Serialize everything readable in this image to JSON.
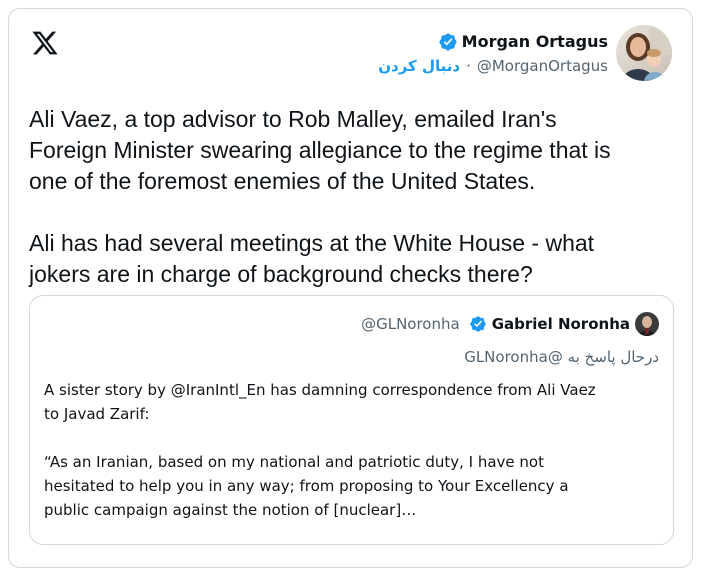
{
  "header": {
    "logo_icon": "x-logo-icon",
    "author_name": "Morgan Ortagus",
    "author_handle": "@MorganOrtagus",
    "separator": "·",
    "follow_label": "دنبال کردن",
    "verified_icon": "verified-badge-icon"
  },
  "tweet": {
    "text": "Ali Vaez, a top advisor to Rob Malley, emailed Iran's\nForeign Minister swearing allegiance to the regime that is\none of the foremost enemies of the United States.\n\nAli has had several meetings at the White House - what\njokers are in charge of background checks there?"
  },
  "quote": {
    "author_name": "Gabriel Noronha",
    "author_handle": "@GLNoronha",
    "reply_line": "درحال پاسخ به @GLNoronha",
    "text": "A sister story by @IranIntl_En has damning correspondence from Ali Vaez\nto Javad Zarif:\n\n“As an Iranian, based on my national and patriotic duty, I have not\nhesitated to help you in any way; from proposing to Your Excellency a\npublic campaign against the notion of [nuclear]…"
  },
  "colors": {
    "accent": "#1d9bf0",
    "text": "#0f1419",
    "muted": "#536471",
    "border": "#cfd9de"
  }
}
